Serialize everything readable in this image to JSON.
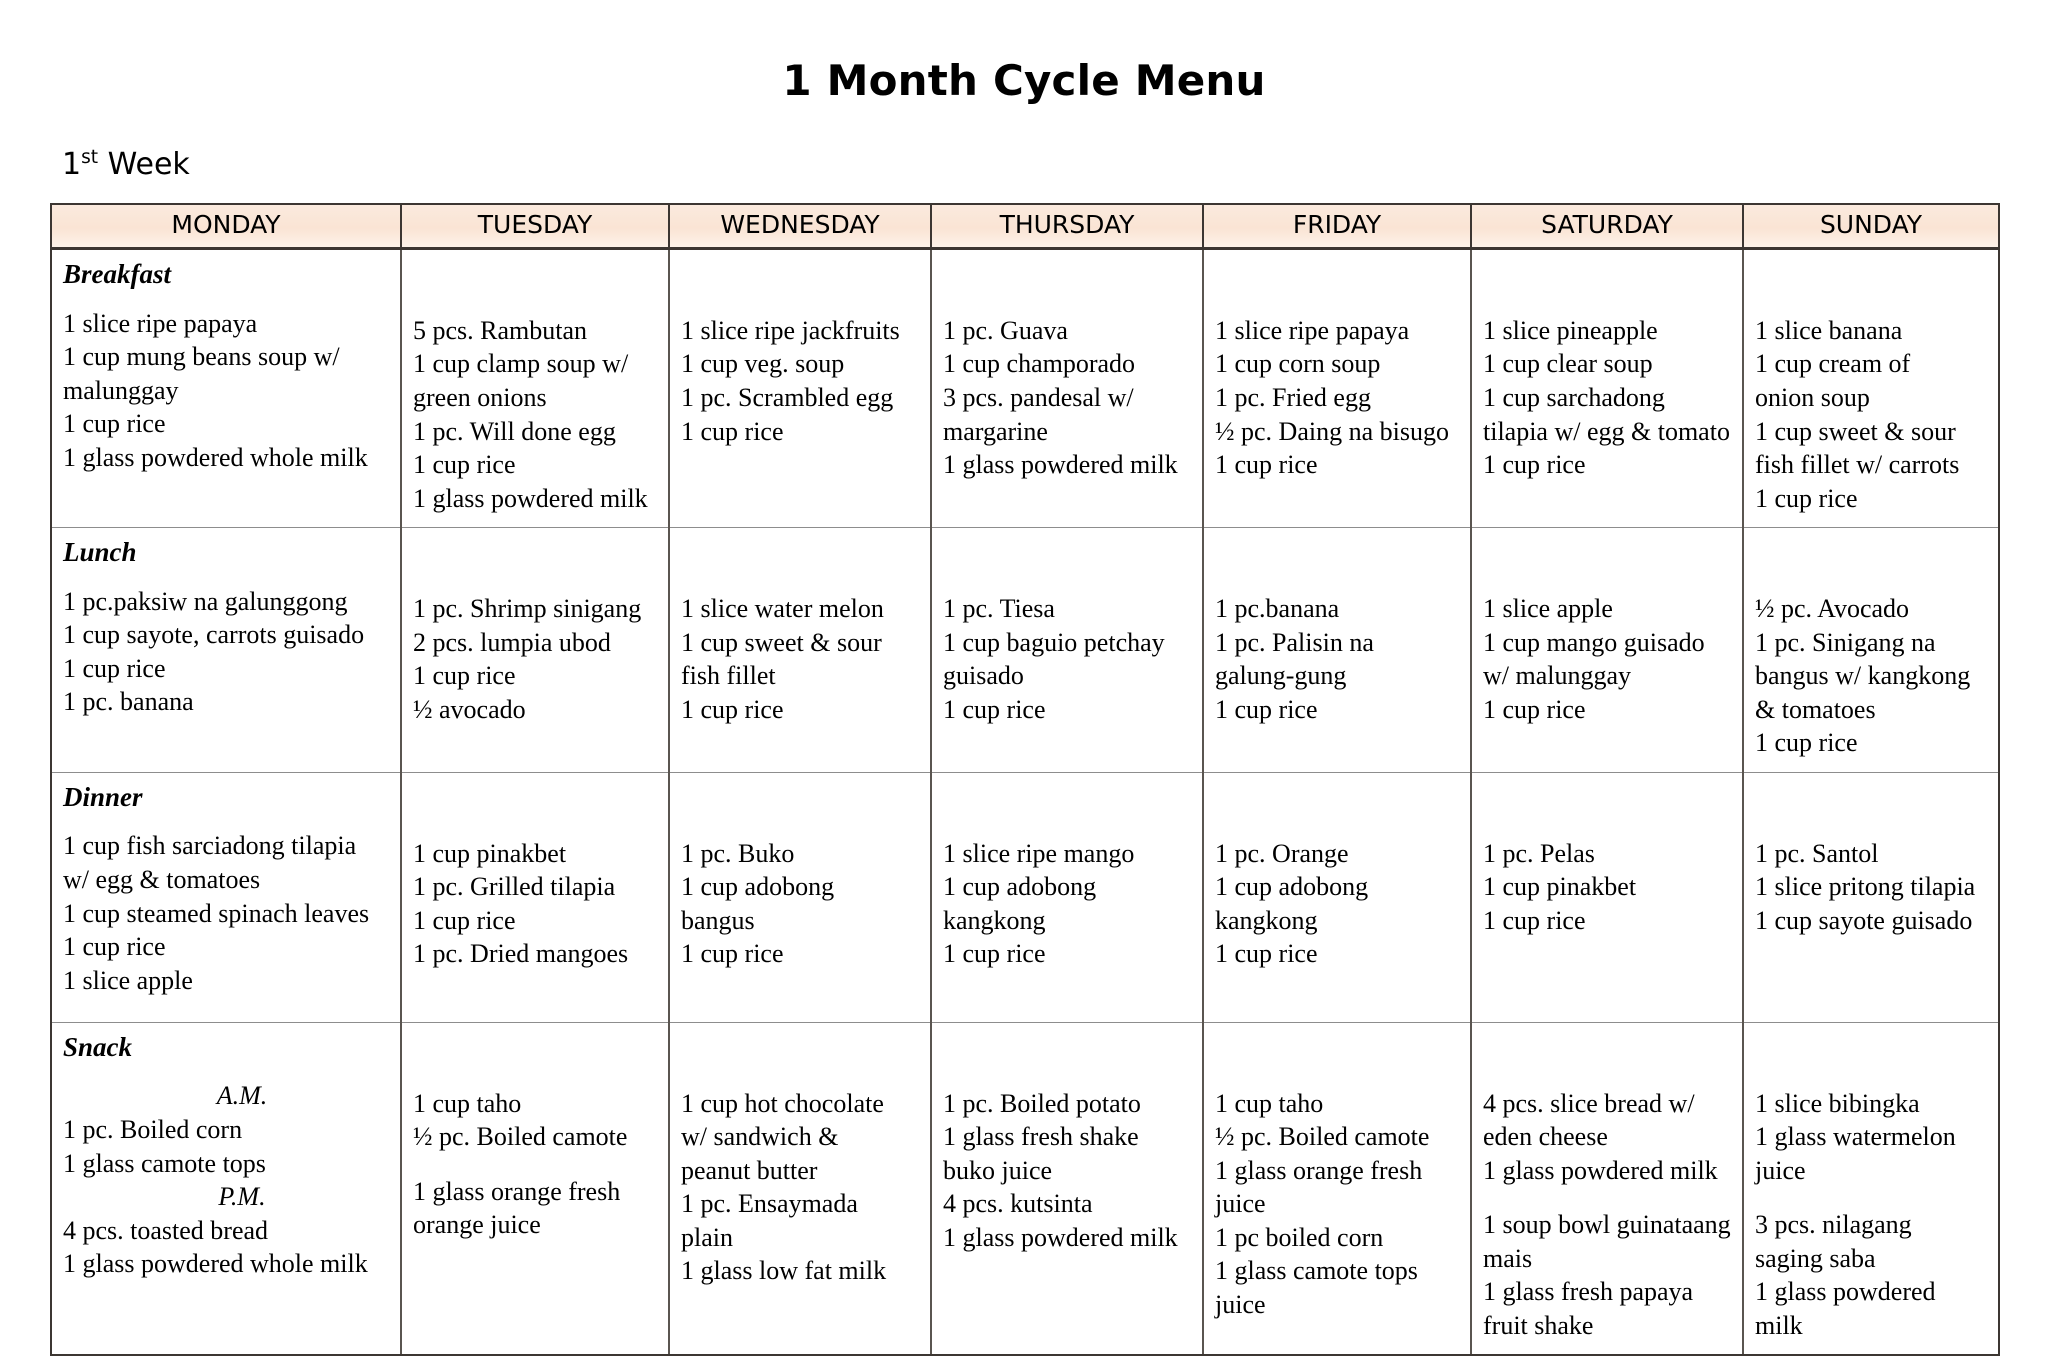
{
  "document": {
    "title": "1 Month Cycle Menu",
    "week_label_number": "1",
    "week_label_ordinal": "st",
    "week_label_text": " Week"
  },
  "table": {
    "columns": [
      "MONDAY",
      "TUESDAY",
      "WEDNESDAY",
      "THURSDAY",
      "FRIDAY",
      "SATURDAY",
      "SUNDAY"
    ],
    "rows": [
      {
        "meal": "Breakfast",
        "cells": [
          [
            "1 slice ripe papaya",
            "1 cup mung beans soup w/",
            "malunggay",
            "1 cup rice",
            "1 glass powdered whole milk"
          ],
          [
            "5 pcs. Rambutan",
            "1 cup clamp soup w/",
            "green onions",
            "1 pc. Will done egg",
            "1 cup rice",
            "1 glass powdered milk"
          ],
          [
            "1 slice ripe jackfruits",
            "1 cup veg. soup",
            "1 pc. Scrambled egg",
            "1 cup rice"
          ],
          [
            "1 pc. Guava",
            "1 cup champorado",
            "3 pcs. pandesal w/",
            "margarine",
            "1 glass powdered milk"
          ],
          [
            "1 slice ripe papaya",
            "1 cup corn soup",
            "1 pc. Fried egg",
            "½ pc. Daing na bisugo",
            "1 cup rice"
          ],
          [
            "1 slice pineapple",
            "1 cup clear soup",
            "1 cup sarchadong",
            "tilapia w/ egg & tomato",
            "1 cup rice"
          ],
          [
            "1 slice banana",
            "1 cup cream of",
            "onion soup",
            "1 cup sweet & sour",
            "fish fillet w/ carrots",
            "1 cup rice"
          ]
        ]
      },
      {
        "meal": "Lunch",
        "cells": [
          [
            "1 pc.paksiw na galunggong",
            "1 cup sayote, carrots guisado",
            "1 cup rice",
            "1 pc. banana"
          ],
          [
            "1 pc. Shrimp sinigang",
            "2 pcs. lumpia ubod",
            "1 cup rice",
            "½ avocado"
          ],
          [
            "1 slice water melon",
            "1 cup sweet & sour",
            "fish fillet",
            "1 cup rice"
          ],
          [
            "1 pc. Tiesa",
            "1 cup baguio petchay",
            "guisado",
            "1 cup rice"
          ],
          [
            "1 pc.banana",
            "1 pc. Palisin na",
            "galung-gung",
            "1 cup rice"
          ],
          [
            "1 slice apple",
            "1 cup mango guisado",
            "w/ malunggay",
            "1 cup rice"
          ],
          [
            "½ pc. Avocado",
            "1 pc. Sinigang na",
            "bangus w/ kangkong",
            "& tomatoes",
            "1 cup rice"
          ]
        ]
      },
      {
        "meal": "Dinner",
        "cells": [
          [
            "1 cup fish sarciadong tilapia",
            "w/ egg & tomatoes",
            "1 cup steamed spinach leaves",
            "1 cup rice",
            "1 slice apple"
          ],
          [
            "1 cup pinakbet",
            "1 pc. Grilled tilapia",
            "1 cup rice",
            "1 pc. Dried mangoes"
          ],
          [
            "1 pc. Buko",
            "1 cup adobong",
            "bangus",
            "1 cup rice"
          ],
          [
            "1 slice ripe mango",
            "1 cup adobong",
            "kangkong",
            "1 cup rice"
          ],
          [
            "1 pc. Orange",
            "1 cup adobong",
            "kangkong",
            "1 cup rice"
          ],
          [
            "1 pc. Pelas",
            "1 cup pinakbet",
            "1 cup rice"
          ],
          [
            "1 pc. Santol",
            "1 slice pritong tilapia",
            "1 cup sayote guisado"
          ]
        ]
      },
      {
        "meal": "Snack",
        "cells": [
          [
            "A.M.",
            "1 pc. Boiled corn",
            "1 glass camote tops",
            "P.M.",
            "4 pcs. toasted bread",
            "1 glass powdered whole milk"
          ],
          [
            "1 cup taho",
            "½ pc. Boiled camote",
            "",
            "1 glass orange fresh",
            "orange juice"
          ],
          [
            "1 cup hot chocolate",
            "w/ sandwich &",
            "peanut butter",
            "1 pc. Ensaymada",
            "plain",
            "1 glass low fat milk"
          ],
          [
            "1 pc. Boiled potato",
            "1 glass fresh shake",
            "buko juice",
            "4 pcs. kutsinta",
            "1 glass powdered milk"
          ],
          [
            "1 cup taho",
            "½ pc. Boiled camote",
            "1 glass orange fresh",
            "juice",
            "1 pc boiled corn",
            "1 glass camote tops",
            "juice"
          ],
          [
            "4 pcs. slice bread w/",
            "eden cheese",
            "1 glass powdered milk",
            "",
            "1 soup bowl guinataang",
            "mais",
            "1 glass fresh papaya",
            "fruit shake"
          ],
          [
            "1 slice bibingka",
            "1 glass watermelon",
            "juice",
            "",
            "3 pcs. nilagang",
            "saging saba",
            "1 glass powdered",
            "milk"
          ]
        ]
      }
    ],
    "snack_ampm_labels": [
      "A.M.",
      "P.M."
    ],
    "header_bg": "#fae5d6",
    "border_color": "#3c3632"
  }
}
